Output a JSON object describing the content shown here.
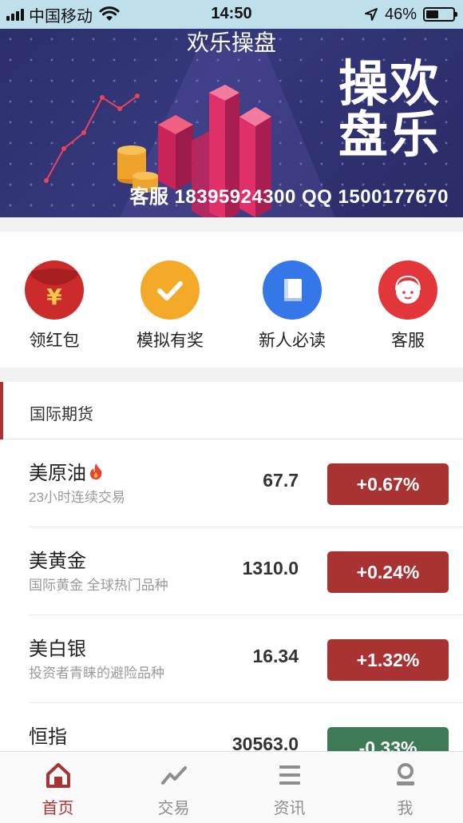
{
  "status_bar": {
    "carrier": "中国移动",
    "time": "14:50",
    "battery": "46%",
    "battery_level": 0.46
  },
  "banner": {
    "top_text": "欢乐操盘",
    "big_line1": "操欢",
    "big_line2": "盘乐",
    "contact": "客服 18395924300  QQ 1500177670"
  },
  "quick_links": [
    {
      "label": "领红包",
      "icon": "red-envelope-icon",
      "color": "#cc2b2b"
    },
    {
      "label": "模拟有奖",
      "icon": "checkmark-icon",
      "color": "#f4aa28"
    },
    {
      "label": "新人必读",
      "icon": "book-icon",
      "color": "#3576e8"
    },
    {
      "label": "客服",
      "icon": "customer-service-icon",
      "color": "#e3363a"
    }
  ],
  "futures": {
    "title": "国际期货",
    "items": [
      {
        "name": "美原油",
        "hot": true,
        "desc": "23小时连续交易",
        "price": "67.7",
        "change": "+0.67%",
        "color": "#a93232"
      },
      {
        "name": "美黄金",
        "hot": false,
        "desc": "国际黄金 全球热门品种",
        "price": "1310.0",
        "change": "+0.24%",
        "color": "#a93232"
      },
      {
        "name": "美白银",
        "hot": false,
        "desc": "投资者青睐的避险品种",
        "price": "16.34",
        "change": "+1.32%",
        "color": "#a93232"
      },
      {
        "name": "恒指",
        "hot": false,
        "desc": "",
        "price": "30563.0",
        "change": "-0.33%",
        "color": "#3d7a55"
      }
    ]
  },
  "tabbar": {
    "items": [
      {
        "label": "首页",
        "icon": "home-icon",
        "active": true
      },
      {
        "label": "交易",
        "icon": "chart-trend-icon",
        "active": false
      },
      {
        "label": "资讯",
        "icon": "news-list-icon",
        "active": false
      },
      {
        "label": "我",
        "icon": "profile-icon",
        "active": false
      }
    ],
    "active_color": "#a93232",
    "inactive_color": "#8e8e8e"
  }
}
